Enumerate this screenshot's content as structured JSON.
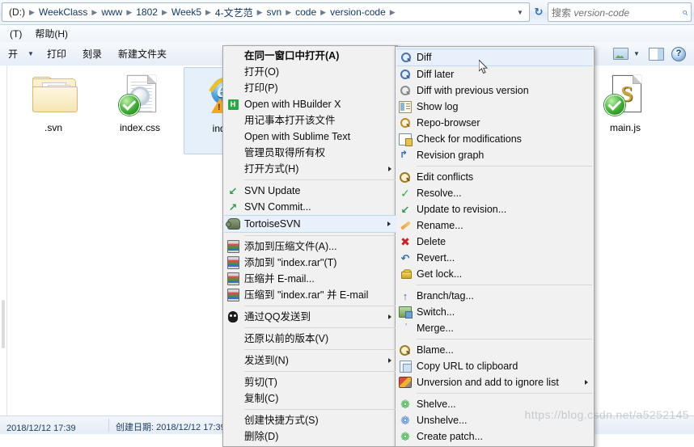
{
  "window": {
    "address": {
      "crumbs": [
        "(D:)",
        "WeekClass",
        "www",
        "1802",
        "Week5",
        "4-文艺范",
        "svn",
        "code",
        "version-code"
      ],
      "dropdown_icon": "chevron-down-icon",
      "refresh_icon": "refresh-icon"
    },
    "search": {
      "placeholder_prefix": "搜索 ",
      "placeholder_target": "version-code",
      "icon": "search-icon"
    },
    "menubar": [
      "(T)",
      "帮助(H)"
    ],
    "toolbar": {
      "organize_caret": "chevron-down-icon",
      "items": [
        "打印",
        "刻录",
        "新建文件夹"
      ],
      "right_icons": [
        "preview-pane-icon",
        "preview-caret-icon",
        "layout-pane-icon",
        "help-icon"
      ]
    },
    "statusbar": {
      "left": "2018/12/12 17:39",
      "right": "创建日期: 2018/12/12 17:39"
    },
    "watermark": "https://blog.csdn.net/a5252145"
  },
  "files": [
    {
      "name": ".svn",
      "icon": "folder-icon",
      "overlay": "svn-modified-badge",
      "selected": false
    },
    {
      "name": "index.css",
      "icon": "css-file-icon",
      "overlay": "svn-normal-badge",
      "selected": false
    },
    {
      "name": "index",
      "icon": "html-file-icon",
      "overlay": "warning-badge",
      "selected": true
    },
    {
      "name": "main.js",
      "icon": "js-file-icon",
      "overlay": "svn-normal-badge",
      "selected": false
    }
  ],
  "context_menu": {
    "items": [
      {
        "label": "在同一窗口中打开(A)",
        "icon": null,
        "bold": true,
        "submenu": false
      },
      {
        "label": "打开(O)",
        "icon": null,
        "bold": false,
        "submenu": false
      },
      {
        "label": "打印(P)",
        "icon": null,
        "bold": false,
        "submenu": false
      },
      {
        "label": "Open with HBuilder X",
        "icon": "hbuilder-icon",
        "bold": false,
        "submenu": false
      },
      {
        "label": "用记事本打开该文件",
        "icon": null,
        "bold": false,
        "submenu": false
      },
      {
        "label": "Open with Sublime Text",
        "icon": null,
        "bold": false,
        "submenu": false
      },
      {
        "label": "管理员取得所有权",
        "icon": null,
        "bold": false,
        "submenu": false
      },
      {
        "label": "打开方式(H)",
        "icon": null,
        "bold": false,
        "submenu": true
      },
      {
        "separator": true
      },
      {
        "label": "SVN Update",
        "icon": "svn-update-icon",
        "bold": false,
        "submenu": false
      },
      {
        "label": "SVN Commit...",
        "icon": "svn-commit-icon",
        "bold": false,
        "submenu": false
      },
      {
        "label": "TortoiseSVN",
        "icon": "tortoise-icon",
        "bold": false,
        "submenu": true,
        "open": true
      },
      {
        "separator": true
      },
      {
        "label": "添加到压缩文件(A)...",
        "icon": "winrar-icon",
        "bold": false,
        "submenu": false
      },
      {
        "label": "添加到 \"index.rar\"(T)",
        "icon": "winrar-icon",
        "bold": false,
        "submenu": false
      },
      {
        "label": "压缩并 E-mail...",
        "icon": "winrar-icon",
        "bold": false,
        "submenu": false
      },
      {
        "label": "压缩到 \"index.rar\" 并 E-mail",
        "icon": "winrar-icon",
        "bold": false,
        "submenu": false
      },
      {
        "separator": true
      },
      {
        "label": "通过QQ发送到",
        "icon": "qq-icon",
        "bold": false,
        "submenu": true
      },
      {
        "separator": true
      },
      {
        "label": "还原以前的版本(V)",
        "icon": null,
        "bold": false,
        "submenu": false
      },
      {
        "separator": true
      },
      {
        "label": "发送到(N)",
        "icon": null,
        "bold": false,
        "submenu": true
      },
      {
        "separator": true
      },
      {
        "label": "剪切(T)",
        "icon": null,
        "bold": false,
        "submenu": false
      },
      {
        "label": "复制(C)",
        "icon": null,
        "bold": false,
        "submenu": false
      },
      {
        "separator": true
      },
      {
        "label": "创建快捷方式(S)",
        "icon": null,
        "bold": false,
        "submenu": false
      },
      {
        "label": "删除(D)",
        "icon": null,
        "bold": false,
        "submenu": false
      }
    ]
  },
  "tortoise_submenu": {
    "items": [
      {
        "label": "Diff",
        "icon": "diff-icon",
        "highlighted": true,
        "submenu": false
      },
      {
        "label": "Diff later",
        "icon": "diff-later-icon",
        "highlighted": false,
        "submenu": false
      },
      {
        "label": "Diff with previous version",
        "icon": "diff-prev-icon",
        "highlighted": false,
        "submenu": false
      },
      {
        "label": "Show log",
        "icon": "show-log-icon",
        "highlighted": false,
        "submenu": false
      },
      {
        "label": "Repo-browser",
        "icon": "repo-browser-icon",
        "highlighted": false,
        "submenu": false
      },
      {
        "label": "Check for modifications",
        "icon": "check-mods-icon",
        "highlighted": false,
        "submenu": false
      },
      {
        "label": "Revision graph",
        "icon": "revision-graph-icon",
        "highlighted": false,
        "submenu": false
      },
      {
        "separator": true
      },
      {
        "label": "Edit conflicts",
        "icon": "edit-conflicts-icon",
        "highlighted": false,
        "submenu": false
      },
      {
        "label": "Resolve...",
        "icon": "resolve-icon",
        "highlighted": false,
        "submenu": false
      },
      {
        "label": "Update to revision...",
        "icon": "update-revision-icon",
        "highlighted": false,
        "submenu": false
      },
      {
        "label": "Rename...",
        "icon": "rename-icon",
        "highlighted": false,
        "submenu": false
      },
      {
        "label": "Delete",
        "icon": "delete-icon",
        "highlighted": false,
        "submenu": false
      },
      {
        "label": "Revert...",
        "icon": "revert-icon",
        "highlighted": false,
        "submenu": false
      },
      {
        "label": "Get lock...",
        "icon": "get-lock-icon",
        "highlighted": false,
        "submenu": false
      },
      {
        "separator": true
      },
      {
        "label": "Branch/tag...",
        "icon": "branch-tag-icon",
        "highlighted": false,
        "submenu": false
      },
      {
        "label": "Switch...",
        "icon": "switch-icon",
        "highlighted": false,
        "submenu": false
      },
      {
        "label": "Merge...",
        "icon": "merge-icon",
        "highlighted": false,
        "submenu": false
      },
      {
        "separator": true
      },
      {
        "label": "Blame...",
        "icon": "blame-icon",
        "highlighted": false,
        "submenu": false
      },
      {
        "label": "Copy URL to clipboard",
        "icon": "copy-url-icon",
        "highlighted": false,
        "submenu": false
      },
      {
        "label": "Unversion and add to ignore list",
        "icon": "ignore-list-icon",
        "highlighted": false,
        "submenu": true
      },
      {
        "separator": true
      },
      {
        "label": "Shelve...",
        "icon": "shelve-icon",
        "highlighted": false,
        "submenu": false
      },
      {
        "label": "Unshelve...",
        "icon": "unshelve-icon",
        "highlighted": false,
        "submenu": false
      },
      {
        "label": "Create patch...",
        "icon": "create-patch-icon",
        "highlighted": false,
        "submenu": false
      }
    ]
  },
  "colors": {
    "menu_bg": "#f1f1f1",
    "menu_border": "#a6a6a6",
    "highlight_bg": "#e8f1fb",
    "highlight_border": "#bcd9f5",
    "selection_bg": "#e6f0fb",
    "crumb_text": "#13386b"
  }
}
